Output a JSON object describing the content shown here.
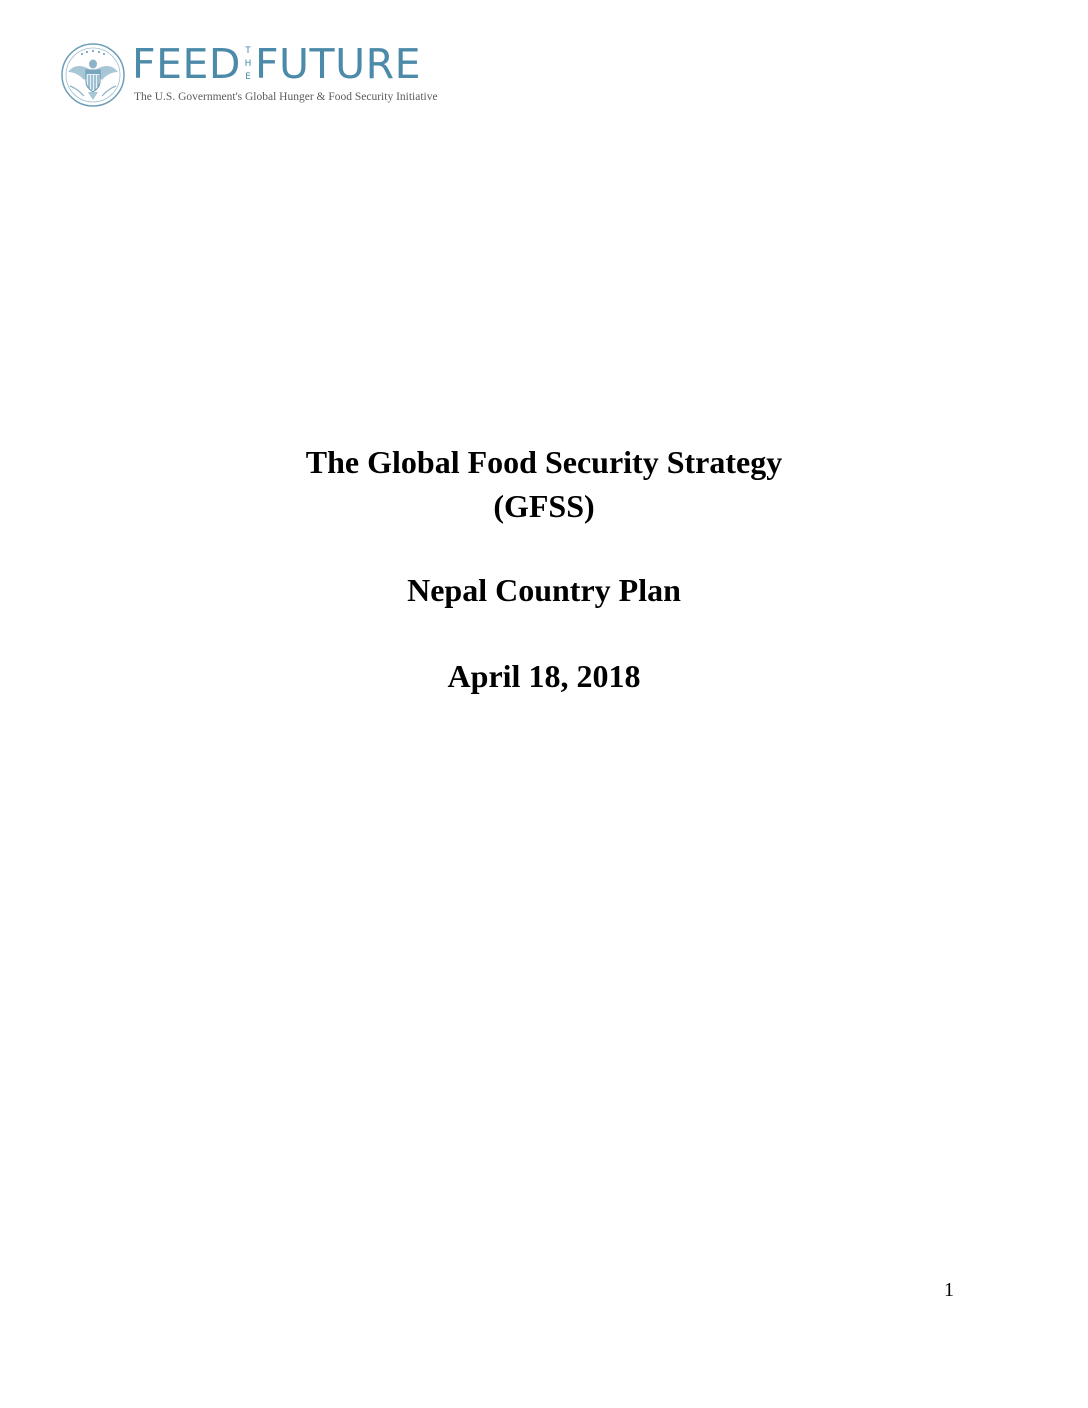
{
  "logo": {
    "feed": "FEED",
    "the_letters": [
      "T",
      "H",
      "E"
    ],
    "future": "FUTURE",
    "tagline": "The U.S. Government's Global Hunger & Food Security Initiative",
    "brand_color": "#4b8ba9",
    "seal_icon": "us-great-seal-icon"
  },
  "title": {
    "line1": "The Global Food Security Strategy",
    "line2": "(GFSS)",
    "subtitle": "Nepal Country Plan",
    "date": "April 18, 2018"
  },
  "footer": {
    "page_number": "1"
  }
}
